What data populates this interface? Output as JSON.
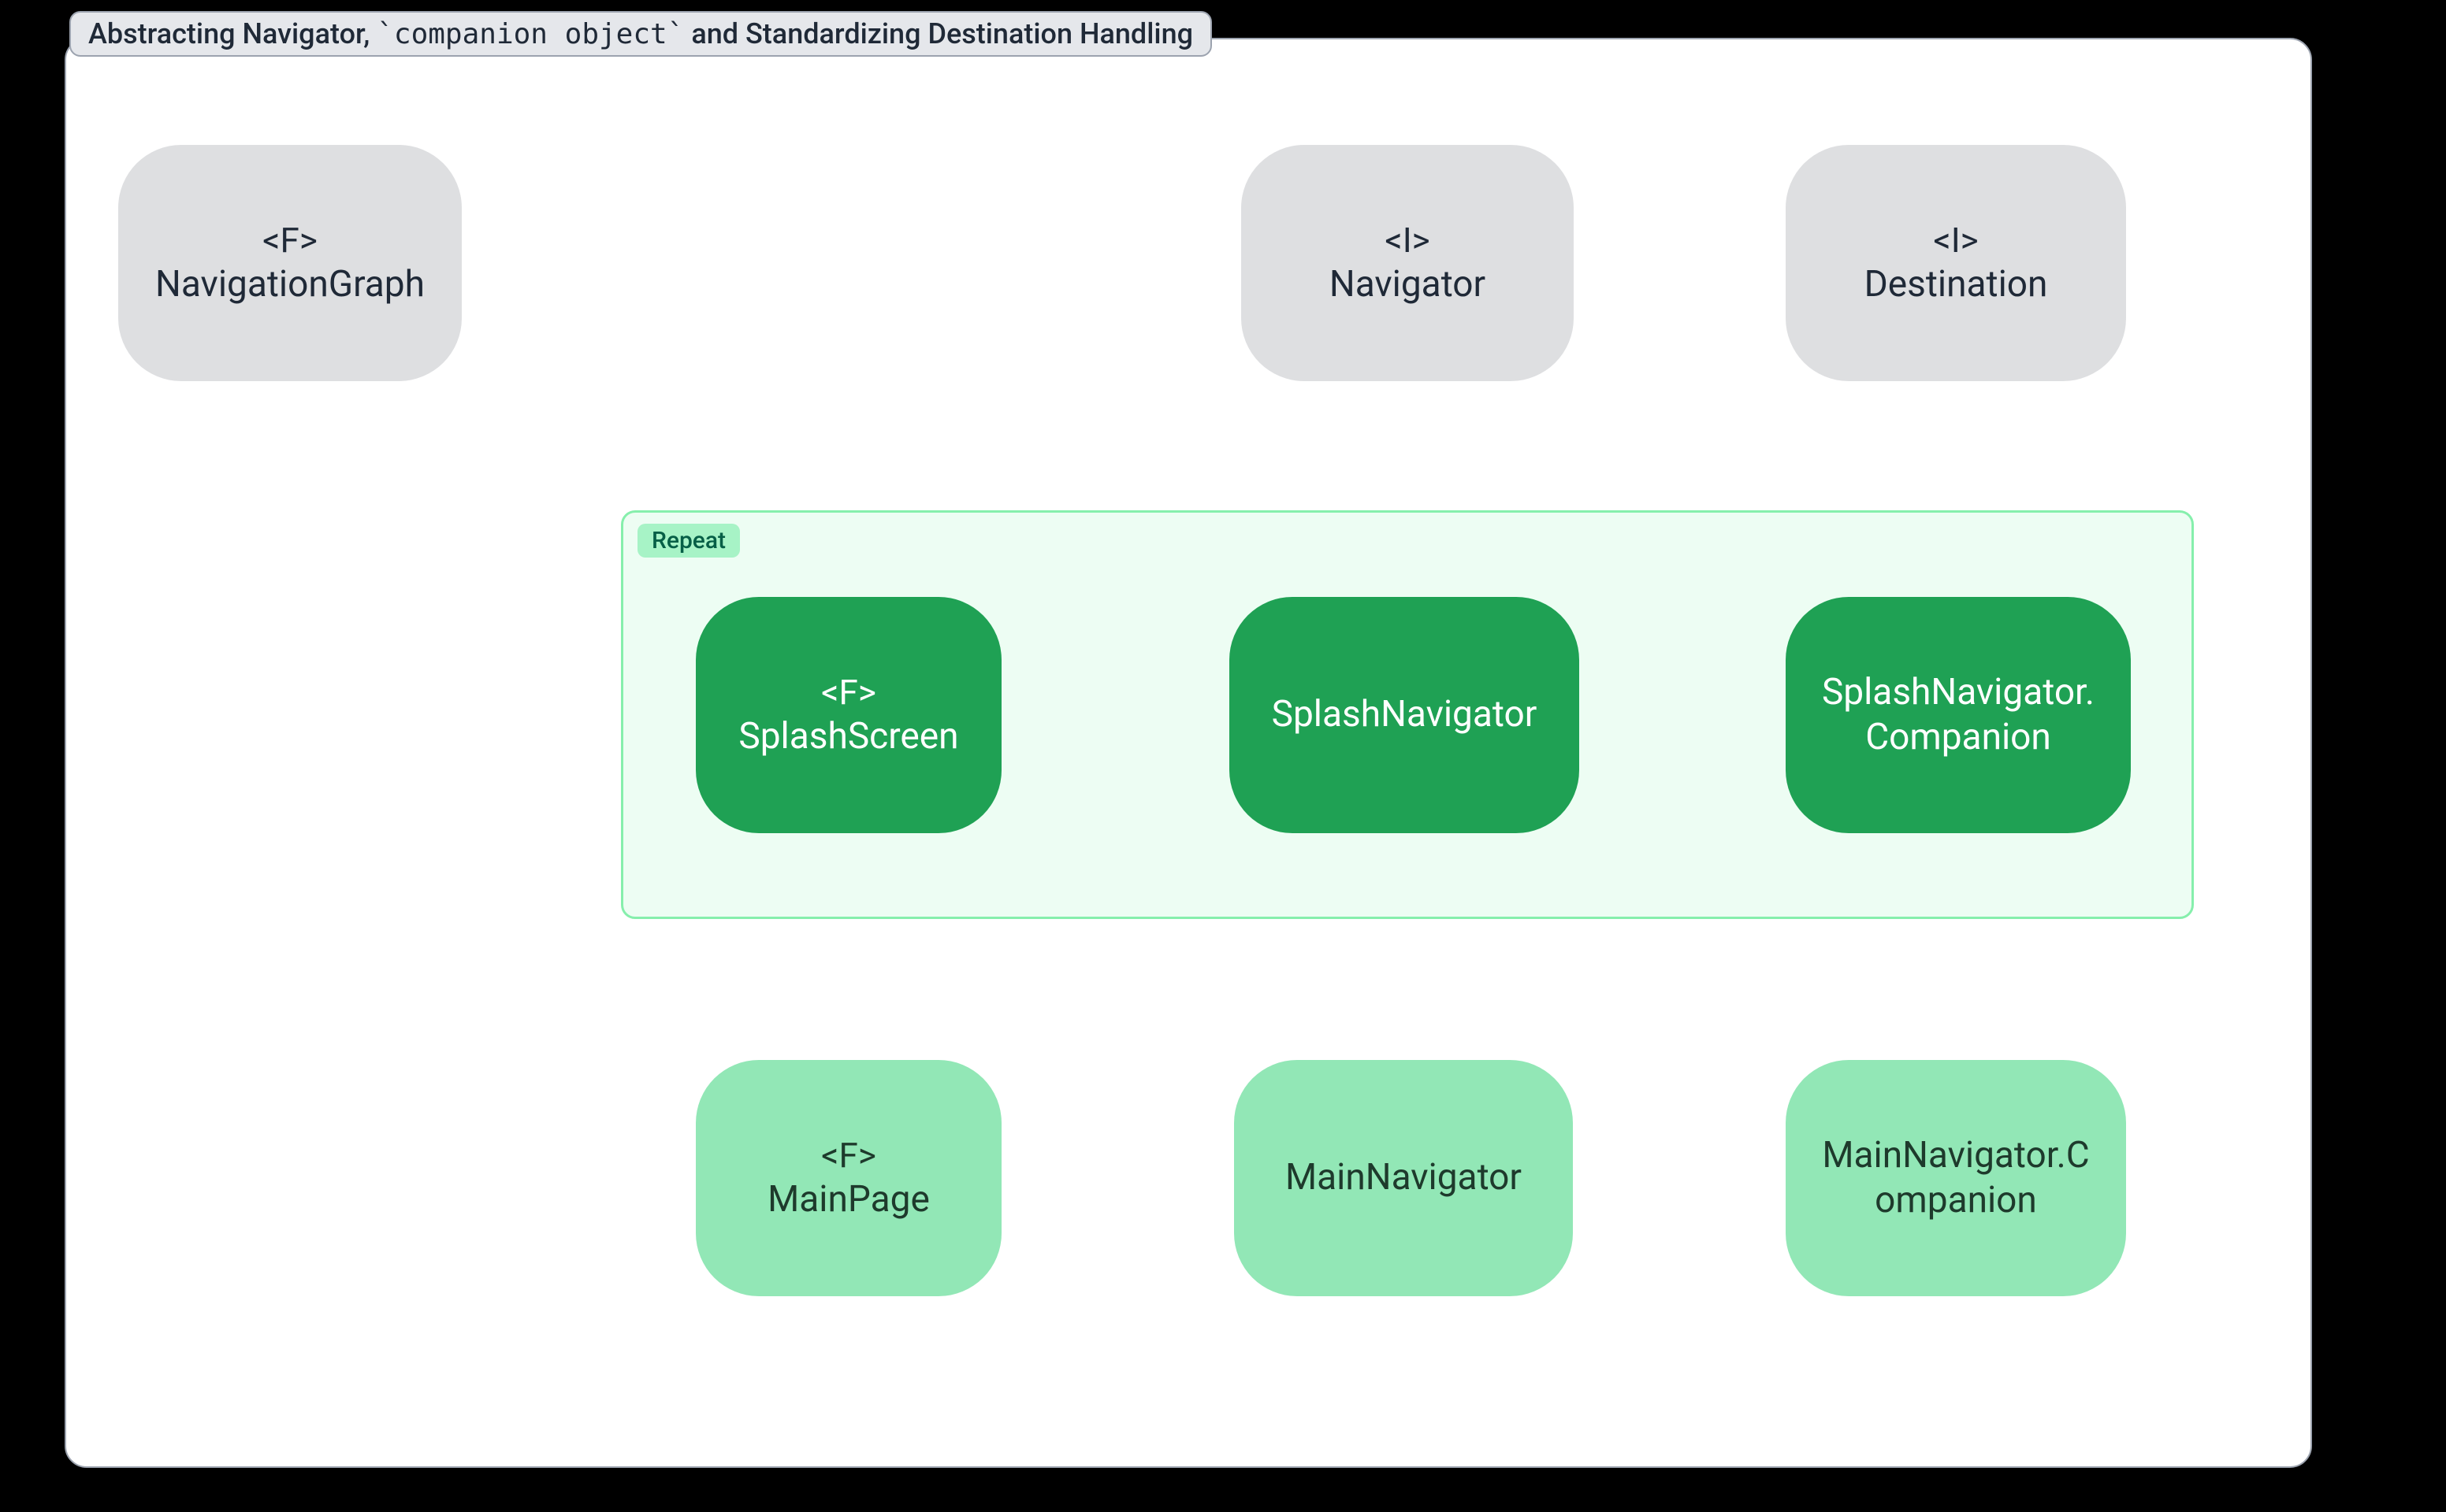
{
  "header": {
    "title": "Abstracting Navigator, `companion object` and Standardizing Destination Handling"
  },
  "group": {
    "label": "Repeat"
  },
  "nodes": {
    "navigationGraph": {
      "stereotype": "<F>",
      "name": "NavigationGraph"
    },
    "navigator": {
      "stereotype": "<I>",
      "name": "Navigator"
    },
    "destination": {
      "stereotype": "<I>",
      "name": "Destination"
    },
    "splashScreen": {
      "stereotype": "<F>",
      "name": "SplashScreen"
    },
    "splashNavigator": {
      "name": "SplashNavigator"
    },
    "splashNavigatorCompanion": {
      "line1": "SplashNavigator.",
      "line2": "Companion"
    },
    "mainPage": {
      "stereotype": "<F>",
      "name": "MainPage"
    },
    "mainNavigator": {
      "name": "MainNavigator"
    },
    "mainNavigatorCompanion": {
      "line1": "MainNavigator.C",
      "line2": "ompanion"
    }
  },
  "colors": {
    "panelBg": "#ffffff",
    "grayNode": "#dedfe1",
    "darkGreenNode": "#1fa154",
    "lightGreenNode": "#92e7b6",
    "repeatBg": "#edfdf3",
    "repeatBorder": "#86efac",
    "arrowGray": "#9da2a9",
    "pageBg": "#000000"
  }
}
